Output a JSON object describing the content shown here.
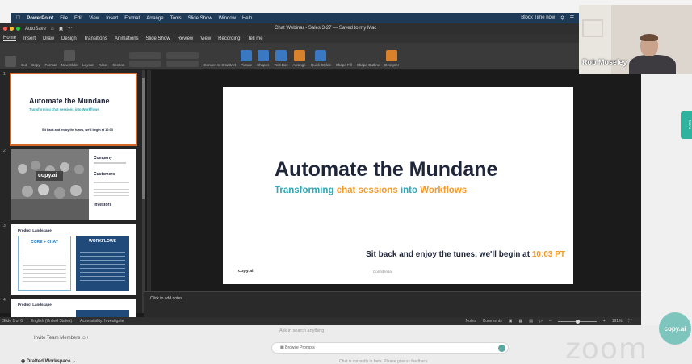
{
  "menubar": {
    "app": "PowerPoint",
    "items": [
      "File",
      "Edit",
      "View",
      "Insert",
      "Format",
      "Arrange",
      "Tools",
      "Slide Show",
      "Window",
      "Help"
    ],
    "status": [
      "Block Time now"
    ]
  },
  "window": {
    "autosave": "AutoSave",
    "title": "Chat Webinar - Sales 3-27 — Saved to my Mac"
  },
  "tabs": [
    "Home",
    "Insert",
    "Draw",
    "Design",
    "Transitions",
    "Animations",
    "Slide Show",
    "Review",
    "View",
    "Recording",
    "Tell me"
  ],
  "ribbon": {
    "groups": [
      "Cut",
      "Copy",
      "Format",
      "New Slide",
      "Layout",
      "Reset",
      "Section",
      "Convert to SmartArt",
      "Picture",
      "Shapes",
      "Text Box",
      "Arrange",
      "Quick Styles",
      "Shape Fill",
      "Shape Outline",
      "Designer"
    ]
  },
  "thumbs": [
    {
      "num": "1",
      "title": "Automate the Mundane",
      "sub": "Transforming chat sessions into Workflows",
      "note": "Sit back and enjoy the tunes, we'll begin at 10:03"
    },
    {
      "num": "2",
      "heading1": "Company",
      "heading2": "Customers",
      "heading3": "Investors",
      "logo": "copy.ai"
    },
    {
      "num": "3",
      "heading": "Product Landscape",
      "box1": "CORE + CHAT",
      "box2": "WORKFLOWS"
    },
    {
      "num": "4",
      "heading": "Product Landscape"
    }
  ],
  "slide": {
    "title": "Automate the Mundane",
    "sub_parts": [
      "Transforming ",
      "chat sessions",
      " into ",
      "Workflows"
    ],
    "note_text": "Sit back and enjoy the tunes, we'll begin at ",
    "note_time": "10:03 PT",
    "logo": "copy.ai",
    "confidential": "Confidential"
  },
  "notes": {
    "placeholder": "Click to add notes"
  },
  "statusbar": {
    "slide": "Slide 1 of 6",
    "language": "English (United States)",
    "accessibility": "Accessibility: Investigate",
    "notes": "Notes",
    "comments": "Comments",
    "zoom": "161%"
  },
  "bottom": {
    "invite": "Invite Team Members",
    "drafted": "Drafted Workspace",
    "hint": "Ask in search anything",
    "browse": "Browse Prompts",
    "feedback": "Chat is currently in beta. Please give us feedback",
    "watermark": "zoom"
  },
  "right": {
    "tab_label": "Menu",
    "badge": "copy.ai"
  },
  "video": {
    "name": "Rob Moseley"
  },
  "colors": {
    "teal": "#2fa7b5",
    "orange": "#f19a2a",
    "navy": "#20263a",
    "menubar": "#1e3a56",
    "accent": "#d4692b"
  }
}
